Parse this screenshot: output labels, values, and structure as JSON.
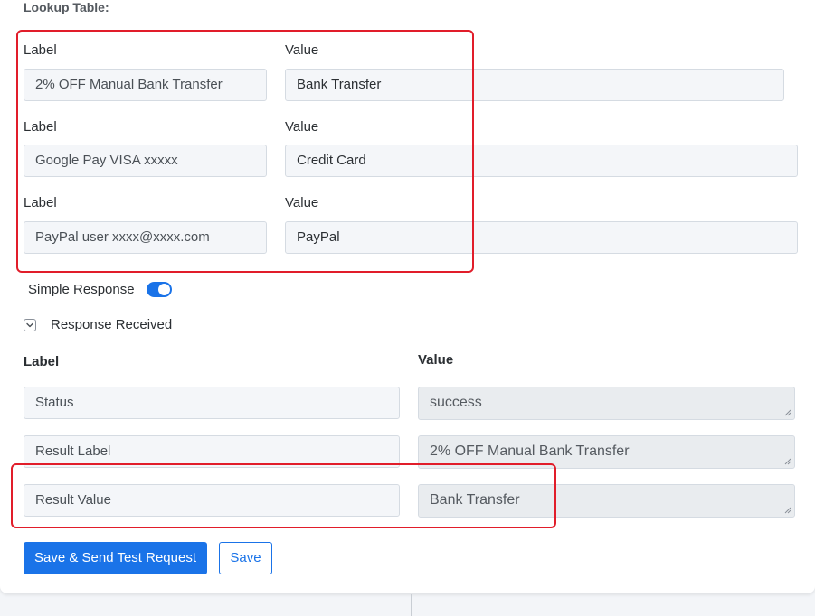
{
  "lookup": {
    "title": "Lookup Table:",
    "rows": [
      {
        "label_heading": "Label",
        "value_heading": "Value",
        "label": "2% OFF Manual Bank Transfer",
        "value": "Bank Transfer"
      },
      {
        "label_heading": "Label",
        "value_heading": "Value",
        "label": "Google Pay VISA xxxxx",
        "value": "Credit Card"
      },
      {
        "label_heading": "Label",
        "value_heading": "Value",
        "label": "PayPal user xxxx@xxxx.com",
        "value": "PayPal"
      }
    ]
  },
  "simple_response": {
    "label": "Simple Response",
    "enabled": true
  },
  "response_received": {
    "label": "Response Received"
  },
  "response_table": {
    "label_header": "Label",
    "value_header": "Value",
    "rows": [
      {
        "label": "Status",
        "value": "success"
      },
      {
        "label": "Result Label",
        "value": "2% OFF Manual Bank Transfer"
      },
      {
        "label": "Result Value",
        "value": "Bank Transfer"
      }
    ]
  },
  "buttons": {
    "save_send": "Save & Send Test Request",
    "save": "Save"
  },
  "colors": {
    "accent": "#1a73e8",
    "highlight": "#e11d2a"
  }
}
